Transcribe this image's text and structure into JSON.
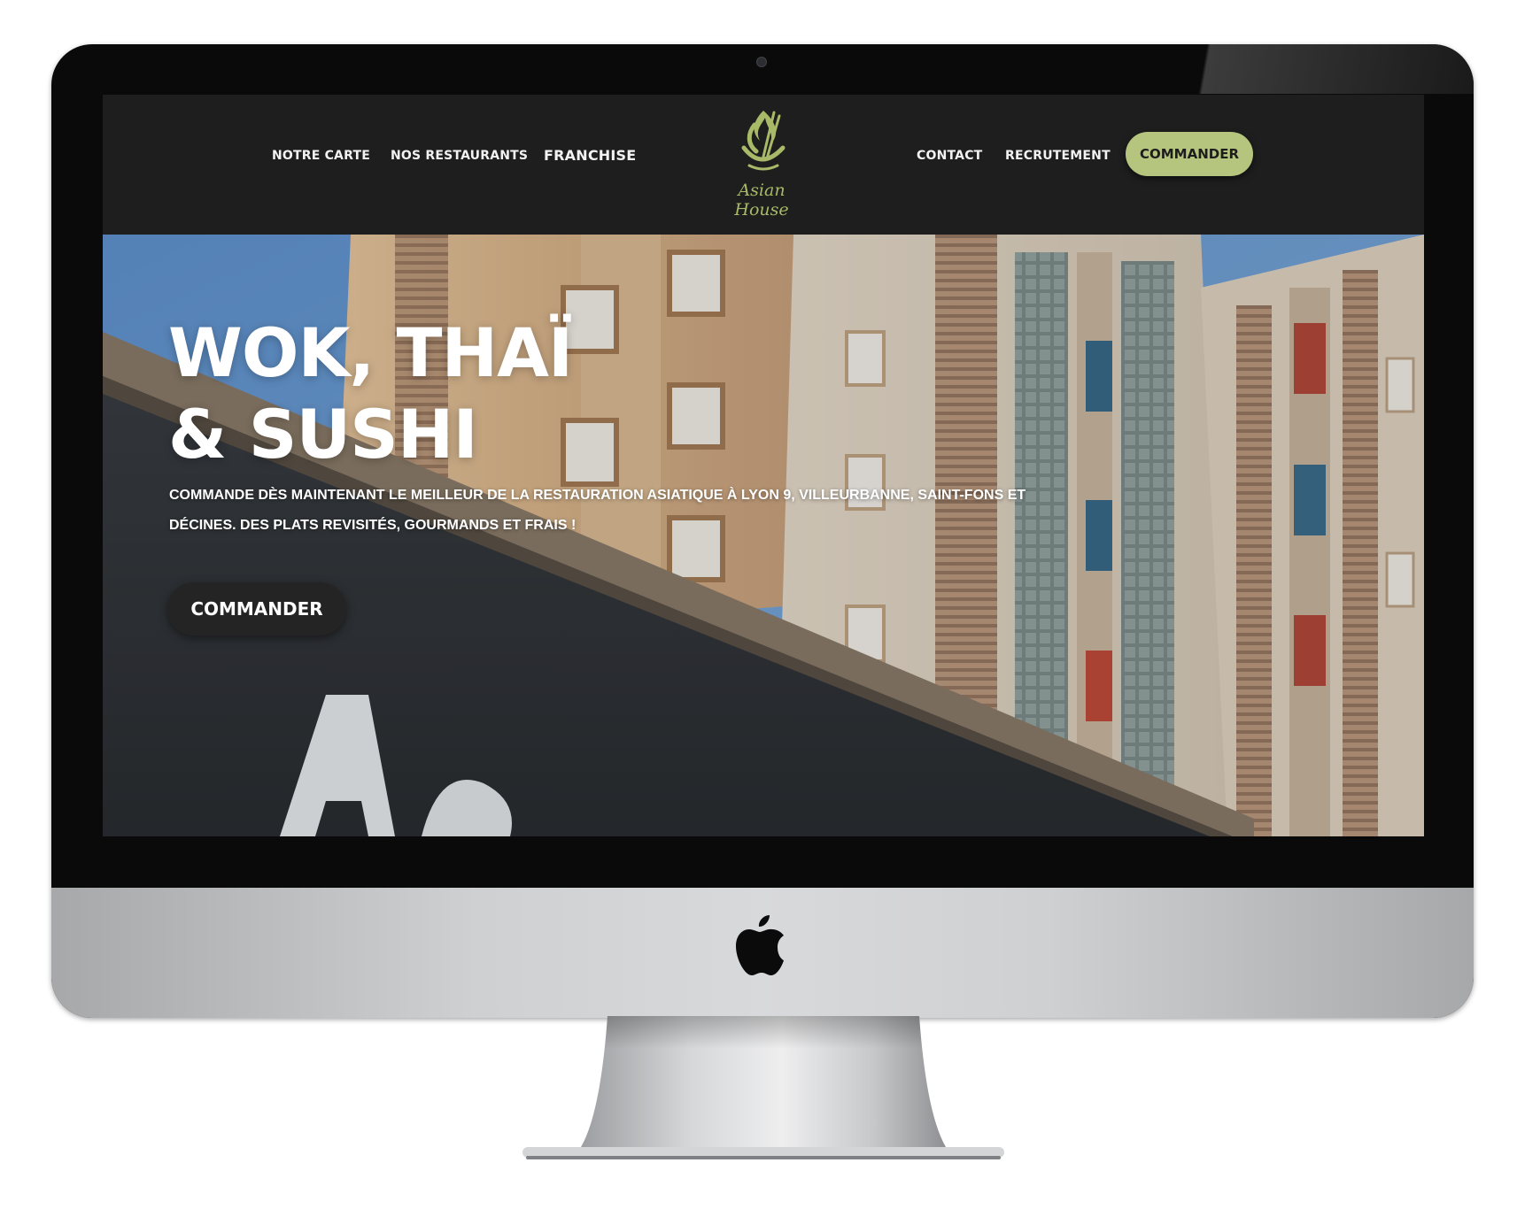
{
  "header": {
    "nav_left": [
      "NOTRE CARTE",
      "NOS RESTAURANTS",
      "FRANCHISE"
    ],
    "nav_right": [
      "CONTACT",
      "RECRUTEMENT"
    ],
    "logo_text": "Asian House",
    "cta_label": "COMMANDER"
  },
  "hero": {
    "title_line1": "WOK, THAÏ",
    "title_line2": "& SUSHI",
    "subtitle": "COMMANDE DÈS MAINTENANT LE MEILLEUR DE LA RESTAURATION ASIATIQUE À LYON 9, VILLEURBANNE, SAINT-FONS ET DÉCINES. DES PLATS REVISITÉS, GOURMANDS ET FRAIS !",
    "cta_label": "COMMANDER"
  },
  "colors": {
    "header_bg": "#1e1e1e",
    "accent_green": "#b5c57e",
    "logo_green": "#a8b968",
    "hero_button_bg": "#242424"
  },
  "icons": {
    "logo": "asian-house-flame-bowl-icon",
    "device_brand": "apple-icon"
  }
}
